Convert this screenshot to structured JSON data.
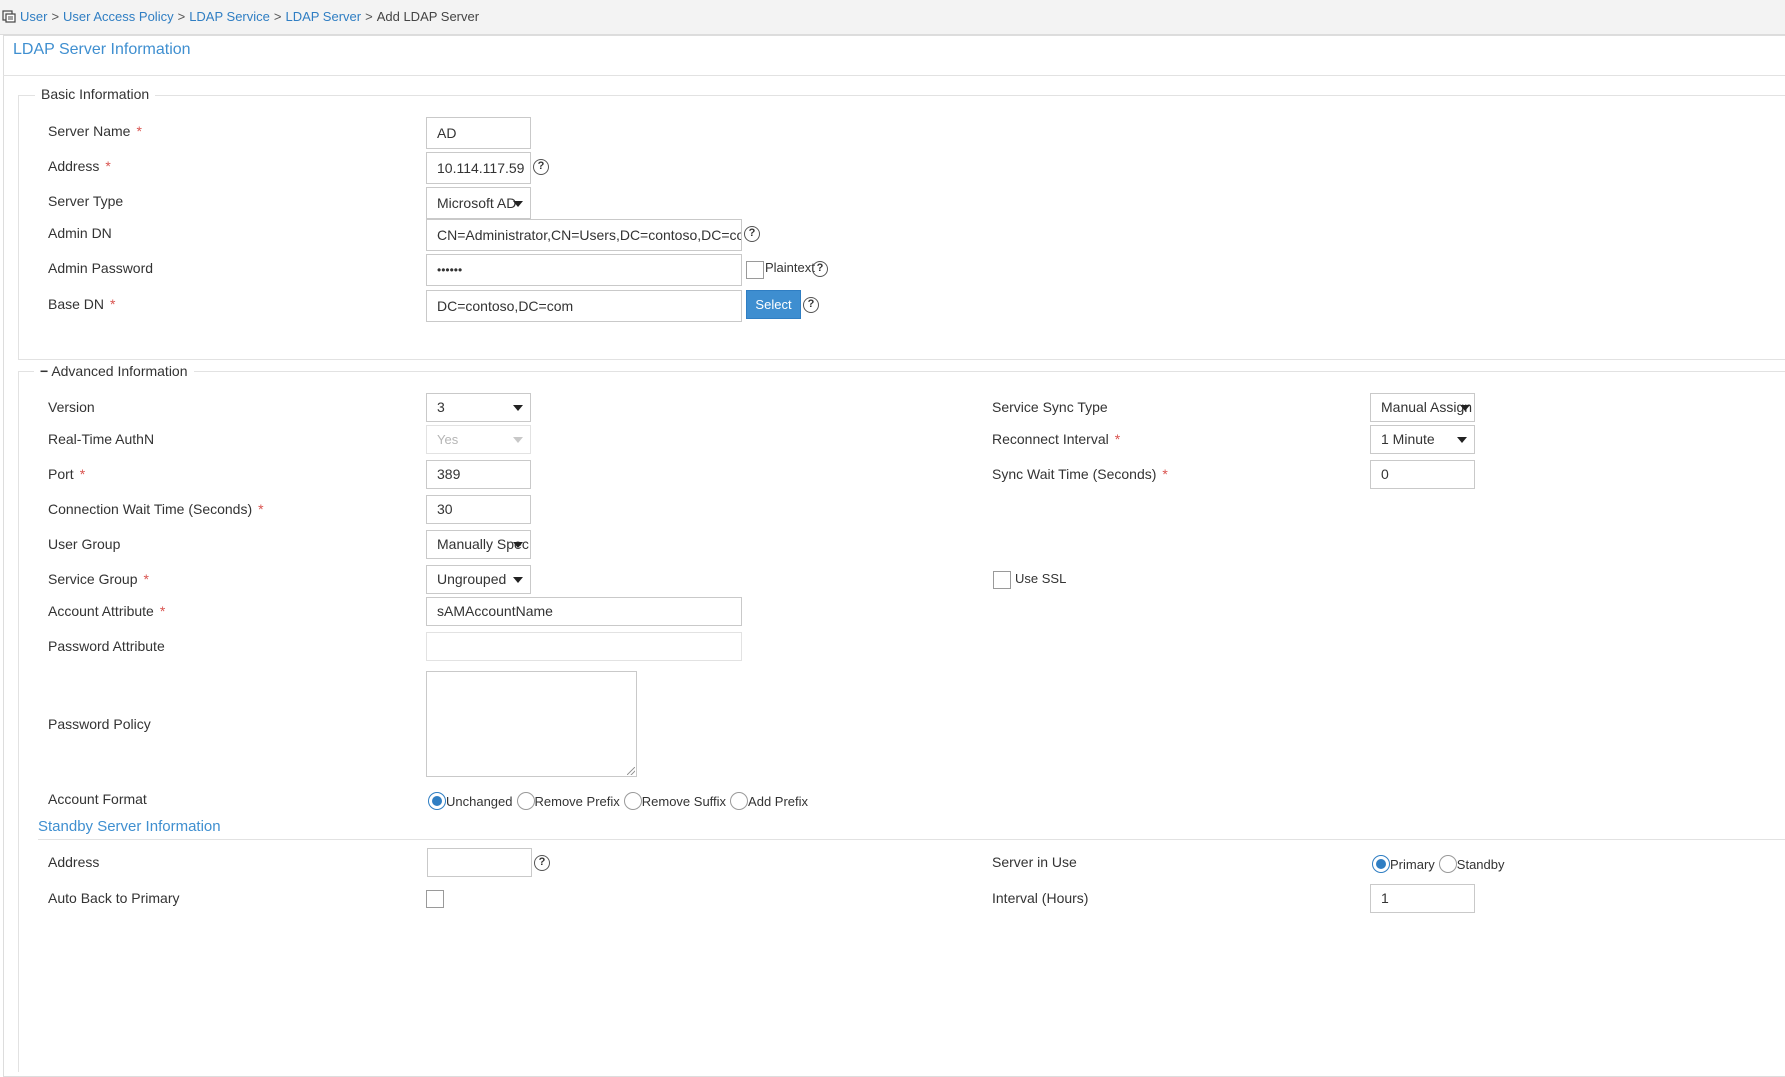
{
  "breadcrumb": {
    "items": [
      "User",
      "User Access Policy",
      "LDAP Service",
      "LDAP Server"
    ],
    "current": "Add LDAP Server",
    "separator": ">"
  },
  "panel_title": "LDAP Server Information",
  "basic": {
    "legend": "Basic Information",
    "server_name": {
      "label": "Server Name",
      "value": "AD",
      "required": "*"
    },
    "address": {
      "label": "Address",
      "value": "10.114.117.59",
      "required": "*"
    },
    "server_type": {
      "label": "Server Type",
      "value": "Microsoft AD"
    },
    "admin_dn": {
      "label": "Admin DN",
      "value": "CN=Administrator,CN=Users,DC=contoso,DC=com"
    },
    "admin_password": {
      "label": "Admin Password",
      "value": "••••••",
      "plaintext_label": "Plaintext"
    },
    "base_dn": {
      "label": "Base DN",
      "value": "DC=contoso,DC=com",
      "required": "*",
      "select_label": "Select"
    }
  },
  "advanced": {
    "toggle": "−",
    "legend": "Advanced Information",
    "version": {
      "label": "Version",
      "value": "3"
    },
    "realtime_authn": {
      "label": "Real-Time AuthN",
      "value": "Yes"
    },
    "port": {
      "label": "Port",
      "value": "389",
      "required": "*"
    },
    "conn_wait": {
      "label": "Connection Wait Time (Seconds)",
      "value": "30",
      "required": "*"
    },
    "user_group": {
      "label": "User Group",
      "value": "Manually Spec"
    },
    "service_group": {
      "label": "Service Group",
      "value": "Ungrouped",
      "required": "*"
    },
    "account_attr": {
      "label": "Account Attribute",
      "value": "sAMAccountName",
      "required": "*"
    },
    "password_attr": {
      "label": "Password Attribute",
      "value": ""
    },
    "password_policy": {
      "label": "Password Policy",
      "value": ""
    },
    "account_format": {
      "label": "Account Format",
      "options": [
        "Unchanged",
        "Remove Prefix",
        "Remove Suffix",
        "Add Prefix"
      ],
      "selected": "Unchanged"
    },
    "service_sync_type": {
      "label": "Service Sync Type",
      "value": "Manual Assign"
    },
    "reconnect_interval": {
      "label": "Reconnect Interval",
      "value": "1 Minute",
      "required": "*"
    },
    "sync_wait": {
      "label": "Sync Wait Time (Seconds)",
      "value": "0",
      "required": "*"
    },
    "use_ssl": {
      "label": "Use SSL",
      "checked": false
    }
  },
  "standby": {
    "title": "Standby Server Information",
    "address": {
      "label": "Address",
      "value": ""
    },
    "auto_back": {
      "label": "Auto Back to Primary",
      "checked": false
    },
    "server_in_use": {
      "label": "Server in Use",
      "options": [
        "Primary",
        "Standby"
      ],
      "selected": "Primary"
    },
    "interval": {
      "label": "Interval (Hours)",
      "value": "1"
    }
  },
  "colors": {
    "accent": "#2f7ec3",
    "required": "#d9534f",
    "button": "#3e8ed0"
  }
}
